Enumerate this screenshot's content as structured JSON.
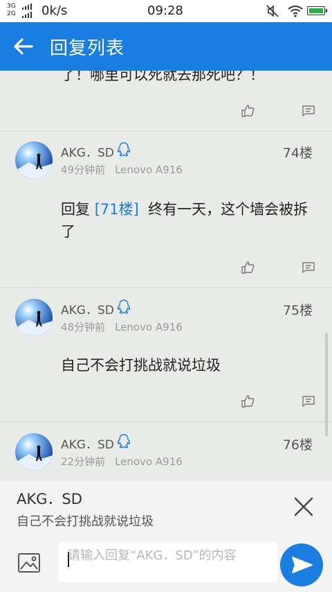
{
  "status_bar": {
    "network_3g": "3G",
    "network_2g": "2G",
    "speed": "0k/s",
    "time": "09:28",
    "icons": [
      "mute-icon",
      "wifi-icon",
      "battery-icon"
    ],
    "battery_color": "#21b24a"
  },
  "header": {
    "title": "回复列表",
    "background": "#1a7ee0"
  },
  "partial_reply": {
    "text": "了！哪里可以死就去那死吧？！"
  },
  "replies": [
    {
      "user": "AKG．SD",
      "floor": "74楼",
      "time": "49分钟前",
      "device": "Lenovo A916",
      "reply_prefix": "回复",
      "reply_ref": "[71楼]",
      "content": "终有一天，这个墙会被拆了"
    },
    {
      "user": "AKG．SD",
      "floor": "75楼",
      "time": "48分钟前",
      "device": "Lenovo A916",
      "content": "自己不会打挑战就说垃圾"
    },
    {
      "user": "AKG．SD",
      "floor": "76楼",
      "time": "22分钟前",
      "device": "Lenovo A916"
    }
  ],
  "reply_box": {
    "target_user": "AKG．SD",
    "quoted_text": "自己不会打挑战就说垃圾",
    "input_placeholder": "请输入回复“AKG．SD”的内容",
    "input_value": ""
  },
  "accent_color": "#1a7ee0"
}
